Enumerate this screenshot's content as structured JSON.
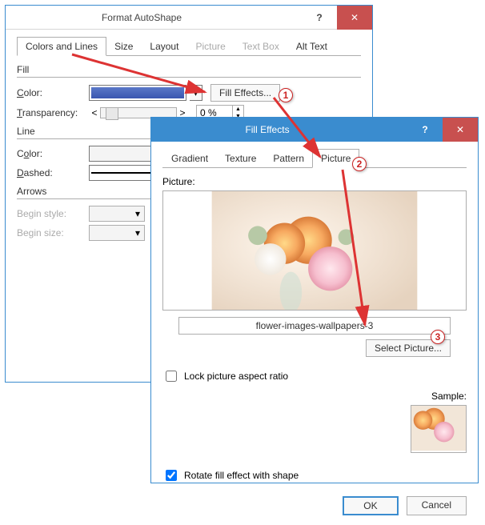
{
  "dialog1": {
    "title": "Format AutoShape",
    "help": "?",
    "close": "✕",
    "tabs": {
      "colors_lines": "Colors and Lines",
      "size": "Size",
      "layout": "Layout",
      "picture": "Picture",
      "textbox": "Text Box",
      "alttext": "Alt Text"
    },
    "sections": {
      "fill": "Fill",
      "line": "Line",
      "arrows": "Arrows"
    },
    "labels": {
      "color": "Color:",
      "transparency": "Transparency:",
      "dashed": "Dashed:",
      "begin_style": "Begin style:",
      "begin_size": "Begin size:"
    },
    "fill_effects_btn": "Fill Effects...",
    "transparency_value": "0 %",
    "fill_color": "#4a66ba",
    "slider_left": "<",
    "slider_right": ">"
  },
  "dialog2": {
    "title": "Fill Effects",
    "help": "?",
    "close": "✕",
    "tabs": {
      "gradient": "Gradient",
      "texture": "Texture",
      "pattern": "Pattern",
      "picture": "Picture"
    },
    "picture_label": "Picture:",
    "picture_name": "flower-images-wallpapers-3",
    "select_picture_btn": "Select Picture...",
    "lock_aspect": "Lock picture aspect ratio",
    "sample_label": "Sample:",
    "rotate_fill": "Rotate fill effect with shape",
    "rotate_checked": true,
    "ok": "OK",
    "cancel": "Cancel"
  },
  "callouts": {
    "c1": "1",
    "c2": "2",
    "c3": "3"
  }
}
